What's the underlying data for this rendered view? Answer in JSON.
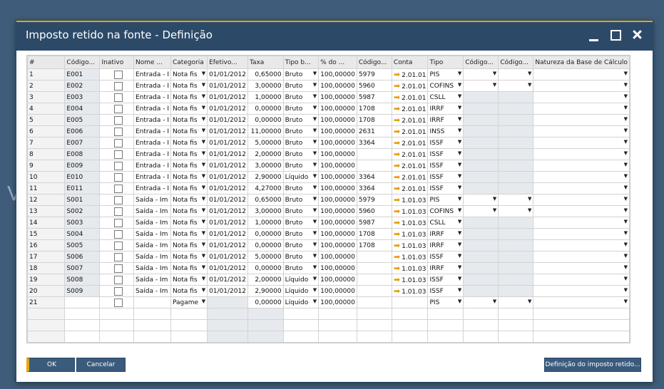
{
  "dialog": {
    "title": "Imposto retido na fonte - Definição"
  },
  "table": {
    "headers": [
      "#",
      "Código...",
      "Inativo",
      "Nome ...",
      "Categoria",
      "Efetivo...",
      "Taxa",
      "Tipo b...",
      "% do ...",
      "Código...",
      "Conta",
      "Tipo",
      "Código...",
      "Código...",
      "Natureza da Base de Cálculo"
    ],
    "rows": [
      {
        "n": "1",
        "code": "E001",
        "name": "Entrada - I",
        "cat": "Nota fis",
        "eff": "01/01/2012",
        "rate": "0,65000",
        "base": "Bruto",
        "pct": "100,00000",
        "c2": "5979",
        "acct": "2.01.01",
        "type": "PIS",
        "dd1": true,
        "dd2": true
      },
      {
        "n": "2",
        "code": "E002",
        "name": "Entrada - I",
        "cat": "Nota fis",
        "eff": "01/01/2012",
        "rate": "3,00000",
        "base": "Bruto",
        "pct": "100,00000",
        "c2": "5960",
        "acct": "2.01.01",
        "type": "COFINS",
        "dd1": true,
        "dd2": true
      },
      {
        "n": "3",
        "code": "E003",
        "name": "Entrada - I",
        "cat": "Nota fis",
        "eff": "01/01/2012",
        "rate": "1,00000",
        "base": "Bruto",
        "pct": "100,00000",
        "c2": "5987",
        "acct": "2.01.01",
        "type": "CSLL",
        "dd1": false,
        "dd2": false
      },
      {
        "n": "4",
        "code": "E004",
        "name": "Entrada - I",
        "cat": "Nota fis",
        "eff": "01/01/2012",
        "rate": "0,00000",
        "base": "Bruto",
        "pct": "100,00000",
        "c2": "1708",
        "acct": "2.01.01",
        "type": "IRRF",
        "dd1": false,
        "dd2": false
      },
      {
        "n": "5",
        "code": "E005",
        "name": "Entrada - I",
        "cat": "Nota fis",
        "eff": "01/01/2012",
        "rate": "0,00000",
        "base": "Bruto",
        "pct": "100,00000",
        "c2": "1708",
        "acct": "2.01.01",
        "type": "IRRF",
        "dd1": false,
        "dd2": false
      },
      {
        "n": "6",
        "code": "E006",
        "name": "Entrada - I",
        "cat": "Nota fis",
        "eff": "01/01/2012",
        "rate": "11,00000",
        "base": "Bruto",
        "pct": "100,00000",
        "c2": "2631",
        "acct": "2.01.01",
        "type": "INSS",
        "dd1": false,
        "dd2": false
      },
      {
        "n": "7",
        "code": "E007",
        "name": "Entrada - I",
        "cat": "Nota fis",
        "eff": "01/01/2012",
        "rate": "5,00000",
        "base": "Bruto",
        "pct": "100,00000",
        "c2": "3364",
        "acct": "2.01.01",
        "type": "ISSF",
        "dd1": false,
        "dd2": false
      },
      {
        "n": "8",
        "code": "E008",
        "name": "Entrada - I",
        "cat": "Nota fis",
        "eff": "01/01/2012",
        "rate": "2,00000",
        "base": "Bruto",
        "pct": "100,00000",
        "c2": "",
        "acct": "2.01.01",
        "type": "ISSF",
        "dd1": false,
        "dd2": false
      },
      {
        "n": "9",
        "code": "E009",
        "name": "Entrada - I",
        "cat": "Nota fis",
        "eff": "01/01/2012",
        "rate": "3,00000",
        "base": "Bruto",
        "pct": "100,00000",
        "c2": "",
        "acct": "2.01.01",
        "type": "ISSF",
        "dd1": false,
        "dd2": false
      },
      {
        "n": "10",
        "code": "E010",
        "name": "Entrada - I",
        "cat": "Nota fis",
        "eff": "01/01/2012",
        "rate": "2,90000",
        "base": "Líquido",
        "pct": "100,00000",
        "c2": "3364",
        "acct": "2.01.01",
        "type": "ISSF",
        "dd1": false,
        "dd2": false
      },
      {
        "n": "11",
        "code": "E011",
        "name": "Entrada - I",
        "cat": "Nota fis",
        "eff": "01/01/2012",
        "rate": "4,27000",
        "base": "Bruto",
        "pct": "100,00000",
        "c2": "3364",
        "acct": "2.01.01",
        "type": "ISSF",
        "dd1": false,
        "dd2": false
      },
      {
        "n": "12",
        "code": "S001",
        "name": "Saída - Im",
        "cat": "Nota fis",
        "eff": "01/01/2012",
        "rate": "0,65000",
        "base": "Bruto",
        "pct": "100,00000",
        "c2": "5979",
        "acct": "1.01.03",
        "type": "PIS",
        "dd1": true,
        "dd2": true
      },
      {
        "n": "13",
        "code": "S002",
        "name": "Saída - Im",
        "cat": "Nota fis",
        "eff": "01/01/2012",
        "rate": "3,00000",
        "base": "Bruto",
        "pct": "100,00000",
        "c2": "5960",
        "acct": "1.01.03",
        "type": "COFINS",
        "dd1": true,
        "dd2": true
      },
      {
        "n": "14",
        "code": "S003",
        "name": "Saída - Im",
        "cat": "Nota fis",
        "eff": "01/01/2012",
        "rate": "1,00000",
        "base": "Bruto",
        "pct": "100,00000",
        "c2": "5987",
        "acct": "1.01.03",
        "type": "CSLL",
        "dd1": false,
        "dd2": false
      },
      {
        "n": "15",
        "code": "S004",
        "name": "Saída - Im",
        "cat": "Nota fis",
        "eff": "01/01/2012",
        "rate": "0,00000",
        "base": "Bruto",
        "pct": "100,00000",
        "c2": "1708",
        "acct": "1.01.03",
        "type": "IRRF",
        "dd1": false,
        "dd2": false
      },
      {
        "n": "16",
        "code": "S005",
        "name": "Saída - Im",
        "cat": "Nota fis",
        "eff": "01/01/2012",
        "rate": "0,00000",
        "base": "Bruto",
        "pct": "100,00000",
        "c2": "1708",
        "acct": "1.01.03",
        "type": "IRRF",
        "dd1": false,
        "dd2": false
      },
      {
        "n": "17",
        "code": "S006",
        "name": "Saída - Im",
        "cat": "Nota fis",
        "eff": "01/01/2012",
        "rate": "5,00000",
        "base": "Bruto",
        "pct": "100,00000",
        "c2": "",
        "acct": "1.01.03",
        "type": "ISSF",
        "dd1": false,
        "dd2": false
      },
      {
        "n": "18",
        "code": "S007",
        "name": "Saída - Im",
        "cat": "Nota fis",
        "eff": "01/01/2012",
        "rate": "0,00000",
        "base": "Bruto",
        "pct": "100,00000",
        "c2": "",
        "acct": "1.01.03",
        "type": "IRRF",
        "dd1": false,
        "dd2": false
      },
      {
        "n": "19",
        "code": "S008",
        "name": "Saída - Im",
        "cat": "Nota fis",
        "eff": "01/01/2012",
        "rate": "2,00000",
        "base": "Líquido",
        "pct": "100,00000",
        "c2": "",
        "acct": "1.01.03",
        "type": "ISSF",
        "dd1": false,
        "dd2": false
      },
      {
        "n": "20",
        "code": "S009",
        "name": "Saída - Im",
        "cat": "Nota fis",
        "eff": "01/01/2012",
        "rate": "2,90000",
        "base": "Líquido",
        "pct": "100,00000",
        "c2": "",
        "acct": "1.01.03",
        "type": "ISSF",
        "dd1": false,
        "dd2": false
      }
    ],
    "new_row": {
      "n": "21",
      "cat": "Pagame",
      "rate": "0,00000",
      "base": "Líquido",
      "pct": "100,00000",
      "type": "PIS"
    }
  },
  "buttons": {
    "ok": "OK",
    "cancel": "Cancelar",
    "definition": "Definição do imposto retido..."
  },
  "colors": {
    "accent": "#e5a70f",
    "titlebar": "#2c4a68",
    "button": "#3b5b7d"
  }
}
